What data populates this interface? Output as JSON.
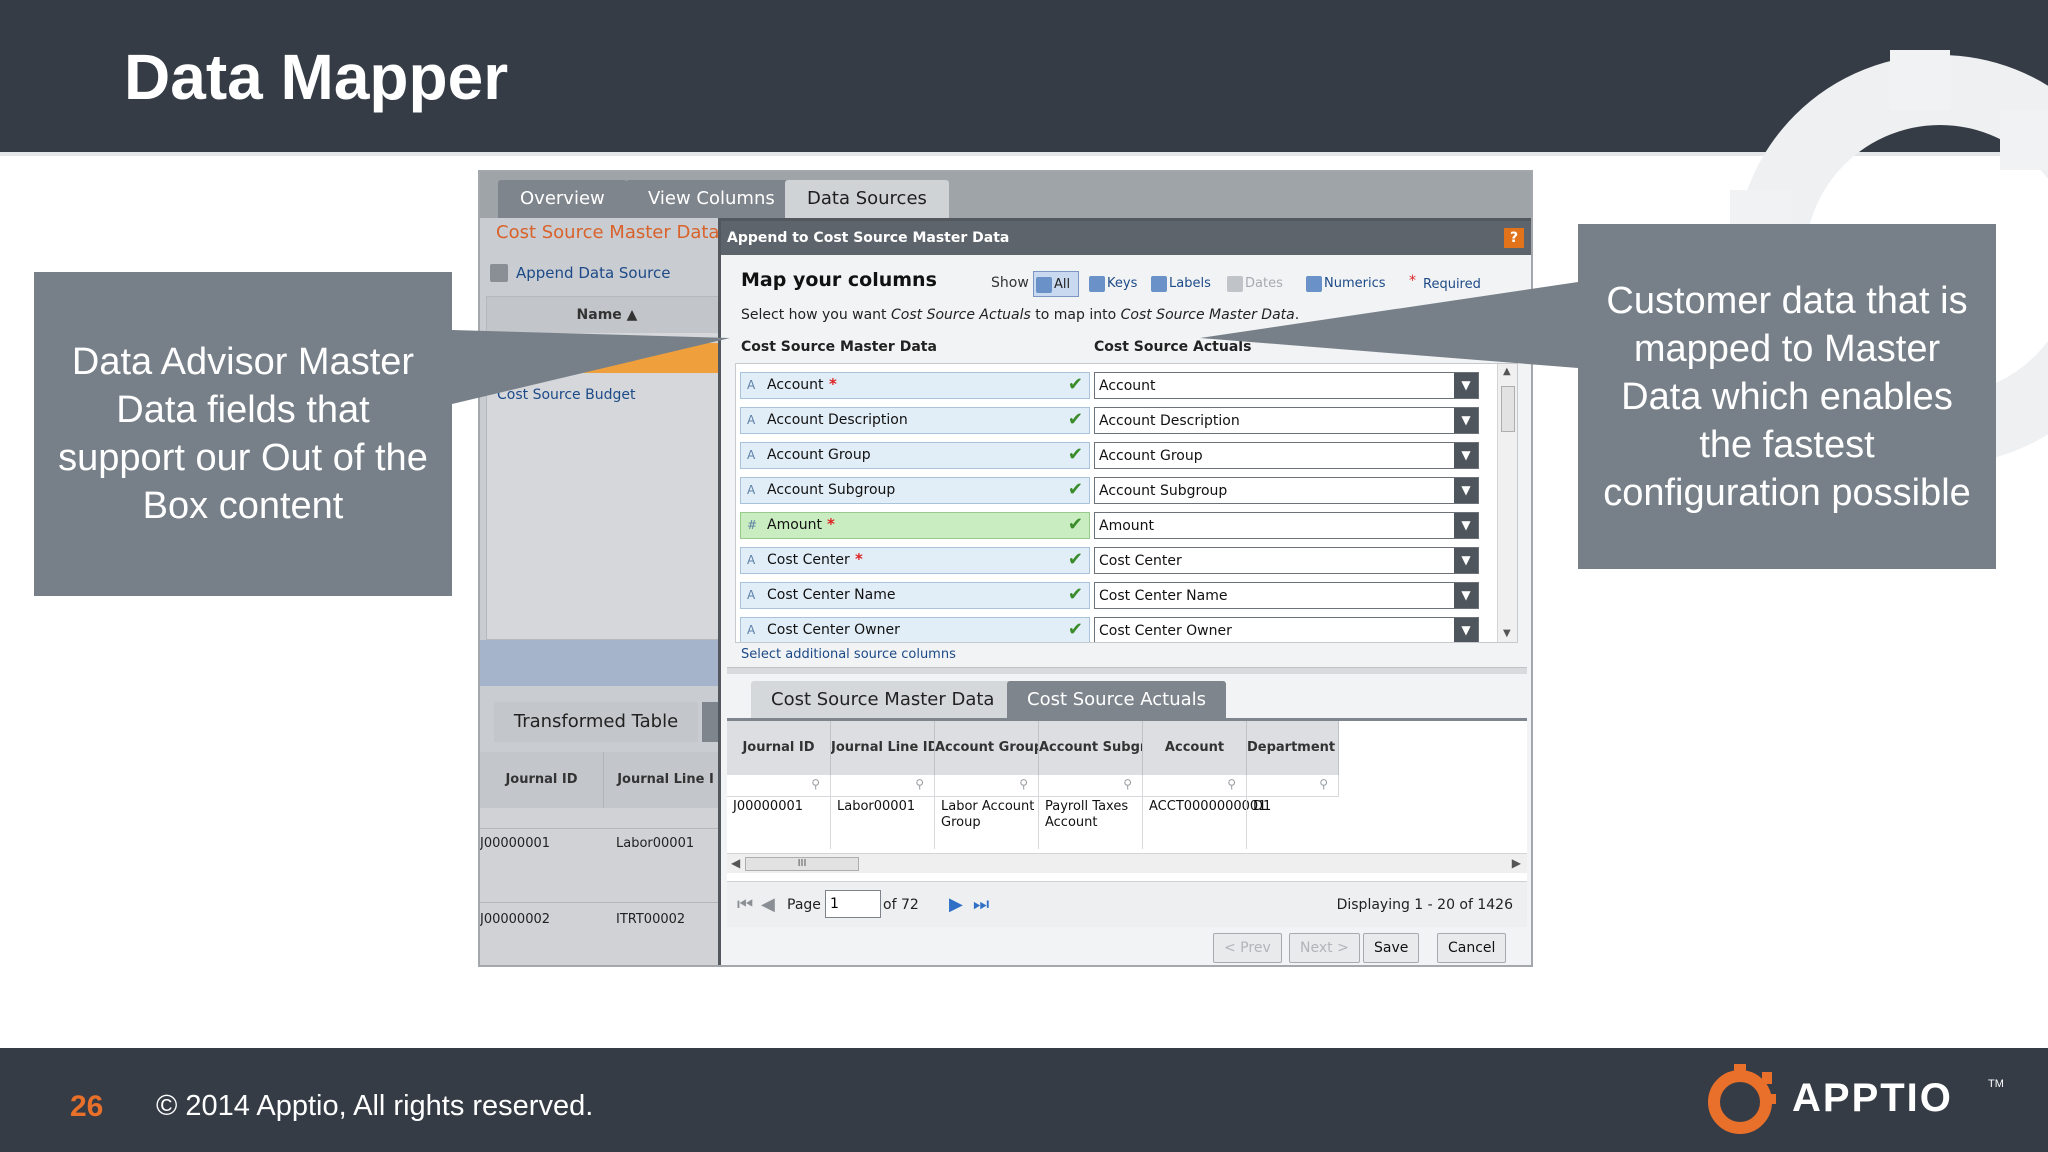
{
  "slide": {
    "title": "Data Mapper",
    "page_number": "26",
    "copyright": "© 2014 Apptio, All rights reserved.",
    "logo_text": "APPTIO",
    "logo_tm": "TM"
  },
  "callouts": {
    "left": "Data Advisor Master Data fields that support our Out of the Box content",
    "right": "Customer data that is mapped to Master Data which enables the fastest configuration possible"
  },
  "app": {
    "tabs": [
      "Overview",
      "View Columns",
      "Data Sources"
    ],
    "active_tab": "Data Sources",
    "background": {
      "title": "Cost Source Master Data",
      "append_label": "Append Data Source",
      "list_header": "Name ▲",
      "list_item": "Cost Source Budget",
      "transformed_tab": "Transformed Table",
      "grid_headers": [
        "Journal ID",
        "Journal Line I"
      ],
      "grid_rows": [
        [
          "J00000001",
          "Labor00001"
        ],
        [
          "J00000002",
          "ITRT00002"
        ]
      ]
    },
    "dialog": {
      "title": "Append to Cost Source Master Data",
      "help": "?",
      "heading": "Map your columns",
      "show_label": "Show",
      "filters": [
        "All",
        "Keys",
        "Labels",
        "Dates",
        "Numerics"
      ],
      "required_label": "Required",
      "instruction_prefix": "Select how you want ",
      "instruction_src": "Cost Source Actuals",
      "instruction_mid": " to map into ",
      "instruction_dst": "Cost Source Master Data",
      "instruction_end": ".",
      "col_left": "Cost Source Master Data",
      "col_right": "Cost Source Actuals",
      "rows": [
        {
          "type": "A",
          "name": "Account",
          "required": true,
          "value": "Account"
        },
        {
          "type": "A",
          "name": "Account Description",
          "required": false,
          "value": "Account Description"
        },
        {
          "type": "A",
          "name": "Account Group",
          "required": false,
          "value": "Account Group"
        },
        {
          "type": "A",
          "name": "Account Subgroup",
          "required": false,
          "value": "Account Subgroup"
        },
        {
          "type": "#",
          "name": "Amount",
          "required": true,
          "value": "Amount"
        },
        {
          "type": "A",
          "name": "Cost Center",
          "required": true,
          "value": "Cost Center"
        },
        {
          "type": "A",
          "name": "Cost Center Name",
          "required": false,
          "value": "Cost Center Name"
        },
        {
          "type": "A",
          "name": "Cost Center Owner",
          "required": false,
          "value": "Cost Center Owner"
        }
      ],
      "add_columns": "Select additional source columns",
      "bottom_tabs": [
        "Cost Source Master Data",
        "Cost Source Actuals"
      ],
      "grid_headers": [
        "Journal ID",
        "Journal Line ID",
        "Account Group",
        "Account Subgroup",
        "Account",
        "Department Cc"
      ],
      "grid_row": [
        "J00000001",
        "Labor00001",
        "Labor Account Group",
        "Payroll Taxes Account",
        "ACCT0000000001",
        "D1"
      ],
      "scroll_thumb": "III",
      "pager": {
        "page_label": "Page",
        "page_value": "1",
        "of_label": "of 72",
        "display": "Displaying 1 - 20 of 1426"
      },
      "buttons": {
        "prev": "< Prev",
        "next": "Next >",
        "save": "Save",
        "cancel": "Cancel"
      }
    }
  },
  "colors": {
    "header_bg": "#353c45",
    "callout_bg": "#778089",
    "accent_orange": "#e8702a"
  }
}
